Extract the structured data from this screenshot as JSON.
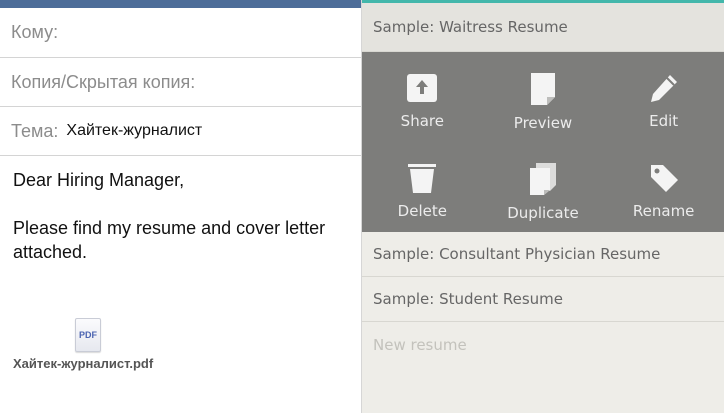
{
  "compose": {
    "to_label": "Кому:",
    "cc_label": "Копия/Скрытая копия:",
    "subject_label": "Тема:",
    "subject_value": "Хайтек-журналист",
    "greeting": "Dear Hiring Manager,",
    "message": "Please find my resume and cover letter attached.",
    "attachment": {
      "icon_text": "PDF",
      "filename": "Хайтек-журналист.pdf"
    }
  },
  "resumes": {
    "selected": "Sample: Waitress Resume",
    "actions": [
      {
        "label": "Share",
        "icon": "share-icon"
      },
      {
        "label": "Preview",
        "icon": "document-icon"
      },
      {
        "label": "Edit",
        "icon": "pencil-icon"
      },
      {
        "label": "Delete",
        "icon": "trash-icon"
      },
      {
        "label": "Duplicate",
        "icon": "duplicate-icon"
      },
      {
        "label": "Rename",
        "icon": "tag-icon"
      }
    ],
    "items": [
      "Sample: Consultant Physician Resume",
      "Sample: Student Resume"
    ],
    "new_placeholder": "New resume"
  },
  "colors": {
    "compose_topbar": "#4d6d99",
    "accent": "#43b7ab",
    "action_panel": "#7d7d7b"
  }
}
